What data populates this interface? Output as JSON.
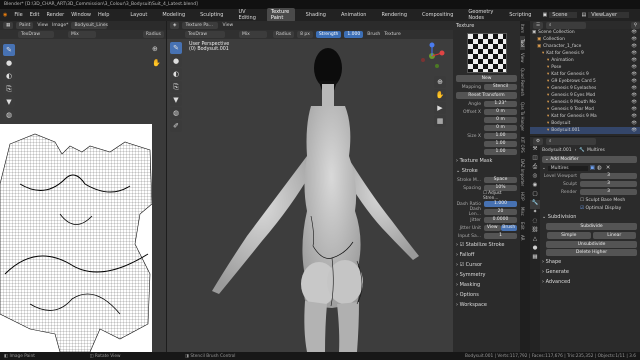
{
  "titlebar": {
    "text": "Blender* [D:\\3D_CHAR_ART\\3D_Commission\\3_Colour\\3_Bodysuit\\Suit_4_Latest.blend]"
  },
  "menus": [
    "File",
    "Edit",
    "Render",
    "Window",
    "Help"
  ],
  "workspace_tabs": [
    "Layout",
    "Modeling",
    "Sculpting",
    "UV Editing",
    "Texture Paint",
    "Shading",
    "Animation",
    "Rendering",
    "Compositing",
    "Geometry Nodes",
    "Scripting"
  ],
  "active_tab": "Texture Paint",
  "scene": {
    "label": "Scene",
    "viewlayer": "ViewLayer"
  },
  "uv_editor": {
    "mode": "Paint",
    "view": "View",
    "image": "Image*",
    "image_name": "Bodysuit_Lines",
    "brush": "TexDraw",
    "blend": "Mix",
    "radius_label": "Radius"
  },
  "viewport": {
    "mode": "Texture Pa...",
    "view": "View",
    "brush": "TexDraw",
    "blend": "Mix",
    "radius_label": "Radius",
    "radius_value": "8 px",
    "strength_label": "Strength",
    "strength_value": "1.000",
    "brush_menu": "Brush",
    "texture_menu": "Texture",
    "overlay_title": "User Perspective",
    "overlay_object": "(0) Bodysuit.001"
  },
  "sidebar": {
    "texture_header": "Texture",
    "new_button": "New",
    "mapping_label": "Mapping",
    "mapping_value": "Stencil",
    "reset_button": "Reset Transform",
    "angle_label": "Angle",
    "angle_value": "1.23°",
    "offset_label": "Offset X",
    "offset_x": "0 m",
    "offset_y": "0 m",
    "offset_z": "0 m",
    "size_label": "Size X",
    "size_x": "1.00",
    "size_y": "1.00",
    "size_z": "1.00",
    "texture_mask": "Texture Mask",
    "stroke_header": "Stroke",
    "stroke_method_label": "Stroke M...",
    "stroke_method_value": "Space",
    "spacing_label": "Spacing",
    "spacing_value": "10%",
    "adjust_strength": "Adjust Stren...",
    "dash_ratio_label": "Dash Ratio",
    "dash_ratio_value": "1.000",
    "dash_length_label": "Dash Len...",
    "dash_length_value": "20",
    "jitter_label": "Jitter",
    "jitter_value": "0.0000",
    "jitter_unit_label": "Jitter Unit",
    "jitter_unit_view": "View",
    "jitter_unit_brush": "Brush",
    "input_samples_label": "Input Sa...",
    "input_samples_value": "1",
    "stabilize": "Stabilize Stroke",
    "falloff": "Falloff",
    "cursor": "Cursor",
    "symmetry": "Symmetry",
    "masking": "Masking",
    "options": "Options",
    "workspace": "Workspace"
  },
  "vertical_tabs": [
    "Item",
    "Tool",
    "View",
    "Quad Remesh",
    "Qas To Hanger",
    "KIT OPS",
    "DAZ Importer",
    "HOP",
    "Misc",
    "Edit",
    "AR"
  ],
  "outliner": {
    "items": [
      {
        "label": "Scene Collection",
        "indent": 0,
        "selected": false
      },
      {
        "label": "Collection",
        "indent": 1,
        "selected": false
      },
      {
        "label": "Character_1_face",
        "indent": 1,
        "selected": false
      },
      {
        "label": "Kat for Genesis 9",
        "indent": 2,
        "selected": false
      },
      {
        "label": "Animation",
        "indent": 3,
        "selected": false
      },
      {
        "label": "Pose",
        "indent": 3,
        "selected": false
      },
      {
        "label": "Kat for Genesis 9",
        "indent": 3,
        "selected": false
      },
      {
        "label": "G9 Eyebrows Card 5",
        "indent": 3,
        "selected": false
      },
      {
        "label": "Genesis 9 Eyelashes",
        "indent": 3,
        "selected": false
      },
      {
        "label": "Genesis 9 Eyes Mod",
        "indent": 3,
        "selected": false
      },
      {
        "label": "Genesis 9 Mouth Mo",
        "indent": 3,
        "selected": false
      },
      {
        "label": "Genesis 9 Tear Mod",
        "indent": 3,
        "selected": false
      },
      {
        "label": "Kat for Genesis 9 Ma",
        "indent": 3,
        "selected": false
      },
      {
        "label": "Bodysuit",
        "indent": 3,
        "selected": false
      },
      {
        "label": "Bodysuit.001",
        "indent": 3,
        "selected": true
      }
    ]
  },
  "properties": {
    "object_name": "Bodysuit.001",
    "modifier_name": "Multires",
    "add_modifier": "Add Modifier",
    "mod_label": "Multires",
    "level_viewport_label": "Level Viewport",
    "level_viewport": "3",
    "sculpt_label": "Sculpt",
    "sculpt_value": "3",
    "render_label": "Render",
    "render_value": "3",
    "sculpt_base_mesh": "Sculpt Base Mesh",
    "optimal_display": "Optimal Display",
    "subdivision": "Subdivision",
    "subdivide": "Subdivide",
    "simple": "Simple",
    "linear": "Linear",
    "unsubdivide": "Unsubdivide",
    "delete_higher": "Delete Higher",
    "shape": "Shape",
    "generate": "Generate",
    "advanced": "Advanced"
  },
  "statusbar": {
    "left": "Image Paint",
    "mid": "Rotate View",
    "center": "Stencil Brush Control",
    "right": "Bodysuit.001 | Verts:117,792 | Faces:117,676 | Tris:235,352 | Objects:1/11 | 3.6"
  },
  "colors": {
    "accent": "#4772b3",
    "selection": "#34466a",
    "bg": "#3d3d3d"
  }
}
